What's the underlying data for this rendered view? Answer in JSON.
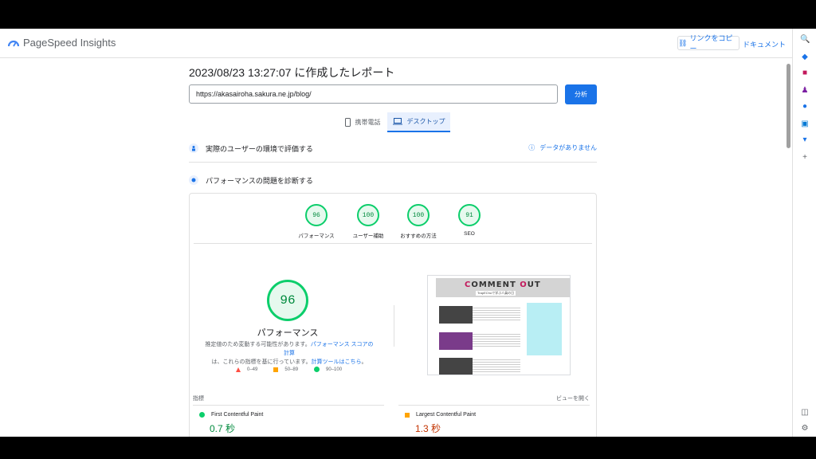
{
  "header": {
    "app_name": "PageSpeed Insights",
    "copy_link_label": "リンクをコピー",
    "docs_label": "ドキュメント"
  },
  "report": {
    "title": "2023/08/23 13:27:07 に作成したレポート",
    "url_value": "https://akasairoha.sakura.ne.jp/blog/",
    "analyze_label": "分析"
  },
  "tabs": [
    {
      "label": "携帯電話",
      "icon": "phone-icon",
      "selected": false
    },
    {
      "label": "デスクトップ",
      "icon": "laptop-icon",
      "selected": true
    }
  ],
  "field_section": {
    "title": "実際のユーザーの環境で評価する",
    "no_data_label": "データがありません"
  },
  "diagnose_section": {
    "title": "パフォーマンスの問題を診断する"
  },
  "scores": [
    {
      "value": "96",
      "label": "パフォーマンス"
    },
    {
      "value": "100",
      "label": "ユーザー補助"
    },
    {
      "value": "100",
      "label": "おすすめの方法"
    },
    {
      "value": "91",
      "label": "SEO"
    }
  ],
  "performance": {
    "score": "96",
    "label": "パフォーマンス",
    "desc_prefix": "推定値のため変動する可能性があります。",
    "desc_link1": "パフォーマンス スコアの計算",
    "desc_middle": "は、これらの指標を基に行っています。",
    "desc_link2": "計算ツールはこちら",
    "desc_suffix": "。"
  },
  "legend": [
    {
      "range": "0–49",
      "color": "#ff4e42"
    },
    {
      "range": "50–89",
      "color": "#ffa400"
    },
    {
      "range": "90–100",
      "color": "#0cce6b"
    }
  ],
  "thumbnail": {
    "brand_1": "C",
    "brand_2": "OMMENT ",
    "brand_3": "O",
    "brand_4": "UT",
    "subtitle": "TrapEChoで学ぶ人員の日"
  },
  "metrics": {
    "header": "指標",
    "expand_label": "ビューを開く",
    "items": [
      {
        "name": "First Contentful Paint",
        "value": "0.7 秒",
        "color": "#0cce6b",
        "value_color": "#008a3d"
      },
      {
        "name": "Largest Contentful Paint",
        "value": "1.3 秒",
        "color": "#ffa400",
        "value_color": "#c33300"
      }
    ]
  },
  "colors": {
    "accent": "#1a73e8",
    "pass": "#0cce6b",
    "average": "#ffa400",
    "fail": "#ff4e42"
  }
}
